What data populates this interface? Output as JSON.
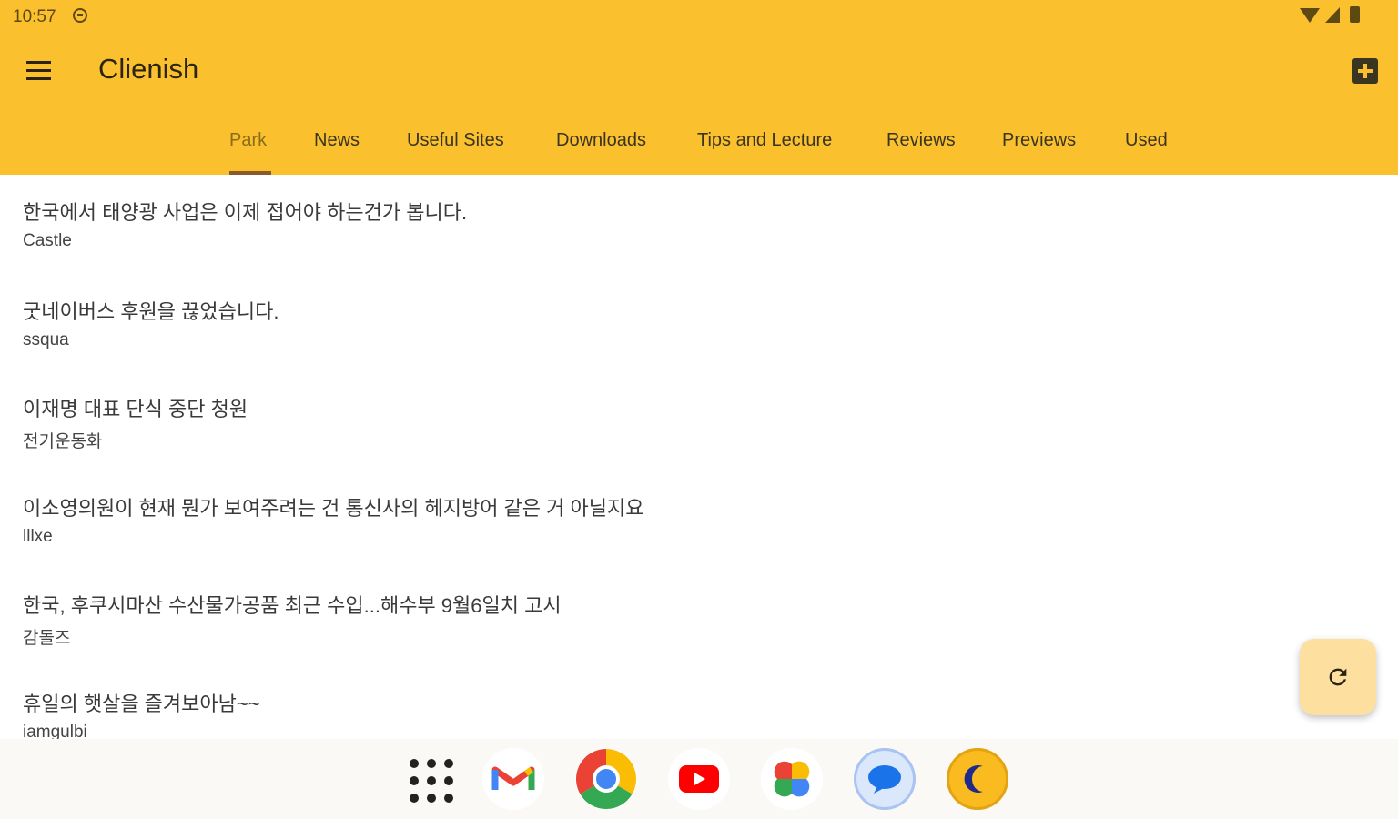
{
  "status": {
    "time": "10:57"
  },
  "app": {
    "title": "Clienish"
  },
  "tabs": [
    {
      "label": "Park"
    },
    {
      "label": "News"
    },
    {
      "label": "Useful Sites"
    },
    {
      "label": "Downloads"
    },
    {
      "label": "Tips and Lecture"
    },
    {
      "label": "Reviews"
    },
    {
      "label": "Previews"
    },
    {
      "label": "Used"
    }
  ],
  "active_tab": "Park",
  "posts": [
    {
      "title": "한국에서 태양광 사업은 이제 접어야 하는건가 봅니다.",
      "author": "Castle"
    },
    {
      "title": "굿네이버스 후원을 끊었습니다.",
      "author": "ssqua"
    },
    {
      "title": "이재명 대표 단식 중단 청원",
      "author": "전기운동화"
    },
    {
      "title": "이소영의원이 현재 뭔가 보여주려는 건 통신사의 헤지방어 같은 거 아닐지요",
      "author": "lllxe"
    },
    {
      "title": "한국, 후쿠시마산 수산물가공품 최근 수입...해수부 9월6일치 고시",
      "author": "감돌즈"
    },
    {
      "title": "휴일의 햇살을 즐겨보아남~~",
      "author": "iamgulbi"
    }
  ],
  "colors": {
    "appbar": "#FBC02D",
    "fab": "#FDE0A0"
  },
  "icons": {
    "menu": "menu-icon",
    "add": "add-box-icon",
    "refresh": "refresh-icon",
    "dock": [
      "apps-grid-icon",
      "gmail-icon",
      "chrome-icon",
      "youtube-icon",
      "photos-icon",
      "messages-icon",
      "night-moon-icon"
    ]
  }
}
